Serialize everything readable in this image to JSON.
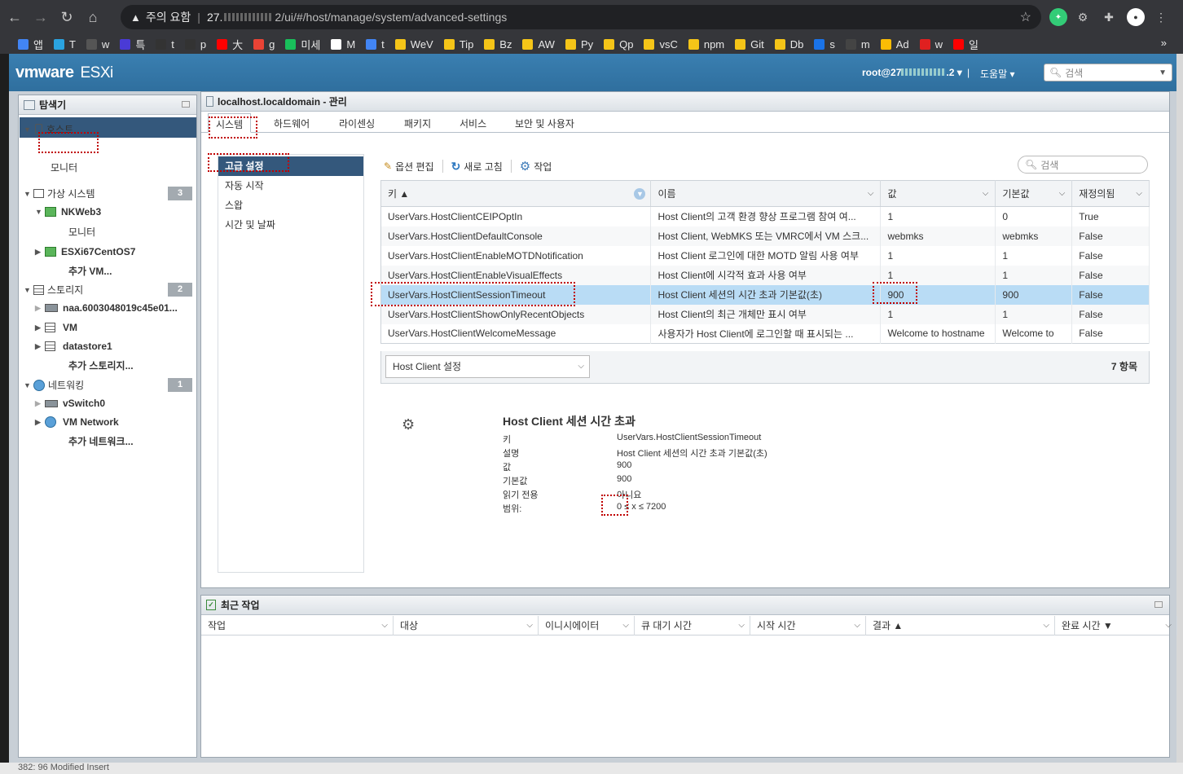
{
  "browser": {
    "security_label": "주의 요함",
    "url_host": "27.",
    "url_mid": "2/ui/#/host/manage/system/advanced-settings",
    "bookmarks": [
      {
        "label": "앱",
        "color": "#4285f4"
      },
      {
        "label": "T",
        "color": "#2aa3e0"
      },
      {
        "label": "w",
        "color": "#555"
      },
      {
        "label": "특",
        "color": "#4a3bd6"
      },
      {
        "label": "t",
        "color": "#333"
      },
      {
        "label": "p",
        "color": "#333"
      },
      {
        "label": "大",
        "color": "#ff0000"
      },
      {
        "label": "g",
        "color": "#ea4335"
      },
      {
        "label": "미세",
        "color": "#19c05b"
      },
      {
        "label": "M",
        "color": "#fff"
      },
      {
        "label": "t",
        "color": "#4285f4"
      },
      {
        "label": "WeV",
        "color": "#f5c518"
      },
      {
        "label": "Tip",
        "color": "#f5c518"
      },
      {
        "label": "Bz",
        "color": "#f5c518"
      },
      {
        "label": "AW",
        "color": "#f5c518"
      },
      {
        "label": "Py",
        "color": "#f5c518"
      },
      {
        "label": "Qp",
        "color": "#f5c518"
      },
      {
        "label": "vsC",
        "color": "#f5c518"
      },
      {
        "label": "npm",
        "color": "#f5c518"
      },
      {
        "label": "Git",
        "color": "#f5c518"
      },
      {
        "label": "Db",
        "color": "#f5c518"
      },
      {
        "label": "s",
        "color": "#1a73e8"
      },
      {
        "label": "m",
        "color": "#444"
      },
      {
        "label": "Ad",
        "color": "#fbbc05"
      },
      {
        "label": "w",
        "color": "#e02020"
      },
      {
        "label": "일",
        "color": "#ff0000"
      }
    ]
  },
  "header": {
    "user": "root@27",
    "user_suffix": ".2 ▾",
    "help": "도움말 ▾",
    "search_placeholder": "검색"
  },
  "navigator": {
    "title": "탐색기",
    "host": "호스트",
    "manage": "관리",
    "monitor": "모니터",
    "vms": "가상 시스템",
    "vms_count": "3",
    "vm1": "NKWeb3",
    "vm1_monitor": "모니터",
    "vm2": "ESXi67CentOS7",
    "vm_more": "추가 VM...",
    "storage": "스토리지",
    "storage_count": "2",
    "st1": "naa.6003048019c45e01...",
    "st2": "VM",
    "st3": "datastore1",
    "st_more": "추가 스토리지...",
    "network": "네트워킹",
    "network_count": "1",
    "net1": "vSwitch0",
    "net2": "VM Network",
    "net_more": "추가 네트워크..."
  },
  "main": {
    "title": "localhost.localdomain - 관리",
    "tabs": [
      "시스템",
      "하드웨어",
      "라이센싱",
      "패키지",
      "서비스",
      "보안 및 사용자"
    ],
    "side": [
      "고급 설정",
      "자동 시작",
      "스왑",
      "시간 및 날짜"
    ],
    "toolbar": {
      "edit": "옵션 편집",
      "refresh": "새로 고침",
      "actions": "작업"
    },
    "search_placeholder": "검색",
    "columns": [
      "키 ▲",
      "이름",
      "값",
      "기본값",
      "재정의됨"
    ],
    "rows": [
      [
        "UserVars.HostClientCEIPOptIn",
        "Host Client의 고객 환경 향상 프로그램 참여 여...",
        "1",
        "0",
        "True"
      ],
      [
        "UserVars.HostClientDefaultConsole",
        "Host Client, WebMKS 또는 VMRC에서 VM 스크...",
        "webmks",
        "webmks",
        "False"
      ],
      [
        "UserVars.HostClientEnableMOTDNotification",
        "Host Client 로그인에 대한 MOTD 알림 사용 여부",
        "1",
        "1",
        "False"
      ],
      [
        "UserVars.HostClientEnableVisualEffects",
        "Host Client에 시각적 효과 사용 여부",
        "1",
        "1",
        "False"
      ],
      [
        "UserVars.HostClientSessionTimeout",
        "Host Client 세션의 시간 초과 기본값(초)",
        "900",
        "900",
        "False"
      ],
      [
        "UserVars.HostClientShowOnlyRecentObjects",
        "Host Client의 최근 개체만 표시 여부",
        "1",
        "1",
        "False"
      ],
      [
        "UserVars.HostClientWelcomeMessage",
        "사용자가 Host Client에 로그인할 때 표시되는 ...",
        "Welcome to hostname",
        "Welcome to",
        "False"
      ]
    ],
    "filter": "Host Client 설정",
    "count": "7 항목",
    "detail": {
      "title": "Host Client 세션 시간 초과",
      "labels": [
        "키",
        "설명",
        "값",
        "기본값",
        "읽기 전용",
        "범위:"
      ],
      "values": [
        "UserVars.HostClientSessionTimeout",
        "Host Client 세션의 시간 초과 기본값(초)",
        "900",
        "900",
        "아니요",
        "0 ≤ x ≤ 7200"
      ]
    }
  },
  "recent": {
    "title": "최근 작업",
    "columns": [
      "작업",
      "대상",
      "이니시에이터",
      "큐 대기 시간",
      "시작 시간",
      "결과 ▲",
      "완료 시간 ▼"
    ]
  },
  "statusbar": {
    "text": "382: 96     Modified     Insert"
  },
  "colors": {
    "header": "#3a7fb1",
    "selected": "#34587c",
    "row_selected": "#b9dcf5",
    "highlight": "#c00000"
  }
}
